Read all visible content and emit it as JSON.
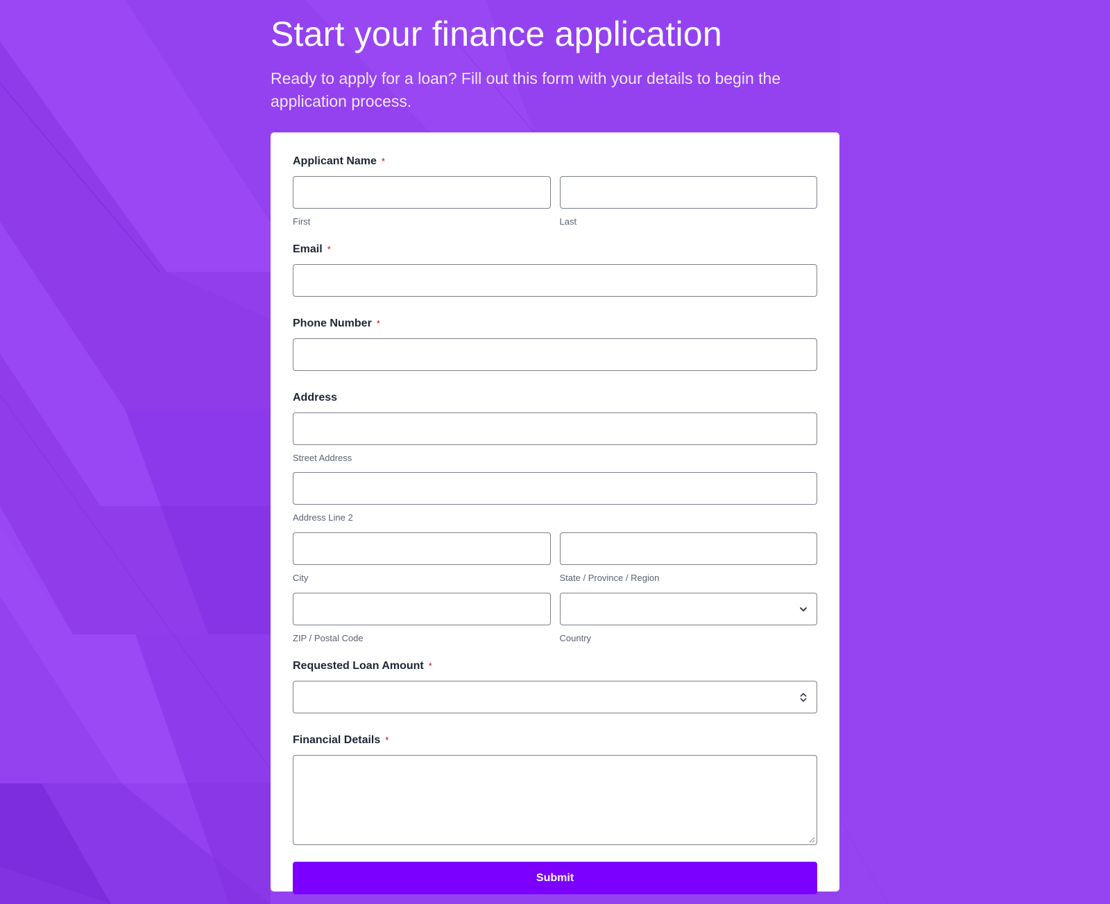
{
  "header": {
    "title": "Start your finance application",
    "subtitle": "Ready to apply for a loan? Fill out this form with your details to begin the application process."
  },
  "form": {
    "required_marker": "*",
    "applicant_name": {
      "label": "Applicant Name",
      "first_sublabel": "First",
      "last_sublabel": "Last",
      "first_value": "",
      "last_value": ""
    },
    "email": {
      "label": "Email",
      "value": ""
    },
    "phone": {
      "label": "Phone Number",
      "value": ""
    },
    "address": {
      "label": "Address",
      "street_sublabel": "Street Address",
      "line2_sublabel": "Address Line 2",
      "city_sublabel": "City",
      "state_sublabel": "State / Province / Region",
      "zip_sublabel": "ZIP / Postal Code",
      "country_sublabel": "Country",
      "country_value": ""
    },
    "loan_amount": {
      "label": "Requested Loan Amount",
      "value": ""
    },
    "financial_details": {
      "label": "Financial Details",
      "value": ""
    },
    "submit_label": "Submit"
  },
  "colors": {
    "background": "#9442f0",
    "button": "#7b00ff",
    "required": "#d0021b"
  },
  "icons": {
    "country": "chevron-down-icon",
    "loan_amount": "stepper-arrows-icon",
    "textarea": "resize-grip-icon"
  }
}
